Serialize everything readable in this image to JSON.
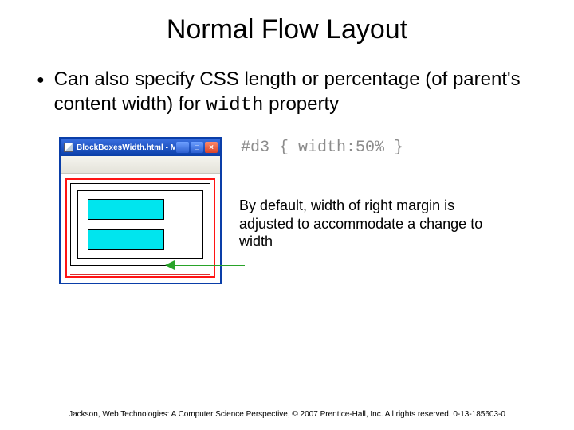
{
  "title": "Normal Flow Layout",
  "bullet": {
    "pre": "Can also specify CSS length or percentage (of parent's content width) for ",
    "code": "width",
    "post": " property"
  },
  "window": {
    "title": "BlockBoxesWidth.html - M...",
    "icon": "page-icon",
    "buttons": {
      "min": "_",
      "max": "□",
      "close": "×"
    }
  },
  "code_snippet": "#d3 { width:50% }",
  "annotation": "By default, width of right margin is adjusted to accommodate a change to width",
  "footer": "Jackson, Web Technologies: A Computer Science Perspective, © 2007 Prentice-Hall, Inc. All rights reserved. 0-13-185603-0"
}
